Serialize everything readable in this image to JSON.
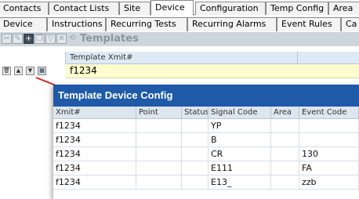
{
  "main_tabs": [
    {
      "label": "Contacts"
    },
    {
      "label": "Contact Lists"
    },
    {
      "label": "Site"
    },
    {
      "label": "Device",
      "active": true
    },
    {
      "label": "Configuration"
    },
    {
      "label": "Temp Config"
    },
    {
      "label": "Area"
    }
  ],
  "sub_tabs": [
    {
      "label": "Device"
    },
    {
      "label": "Instructions"
    },
    {
      "label": "Recurring Tests"
    },
    {
      "label": "Recurring Alarms"
    },
    {
      "label": "Event Rules"
    },
    {
      "label": "Ca"
    }
  ],
  "toolbar": {
    "title": "Templates",
    "icons": [
      "cut-icon",
      "edit-icon",
      "add-icon",
      "copy-icon",
      "filter-icon",
      "delete-icon",
      "refresh-icon"
    ]
  },
  "templates_grid": {
    "columns": [
      "Template Xmit#"
    ],
    "rows": [
      {
        "xmit": "f1234"
      }
    ]
  },
  "popup": {
    "title": "Template Device Config",
    "columns": [
      "Xmit#",
      "Point",
      "Status",
      "Signal Code",
      "Area",
      "Event Code"
    ],
    "rows": [
      {
        "xmit": "f1234",
        "point": "",
        "status": "",
        "signal_code": "YP",
        "area": "",
        "event_code": ""
      },
      {
        "xmit": "f1234",
        "point": "",
        "status": "",
        "signal_code": "B",
        "area": "",
        "event_code": ""
      },
      {
        "xmit": "f1234",
        "point": "",
        "status": "",
        "signal_code": "CR",
        "area": "",
        "event_code": "130"
      },
      {
        "xmit": "f1234",
        "point": "",
        "status": "",
        "signal_code": "E111",
        "area": "",
        "event_code": "FA"
      },
      {
        "xmit": "f1234",
        "point": "",
        "status": "",
        "signal_code": "E13_",
        "area": "",
        "event_code": "zzb"
      }
    ]
  },
  "colors": {
    "popup_title_bg": "#1e5aa8",
    "selected_row_bg": "#fffdd0",
    "toolbar_bg": "#cfd5dc",
    "arrow": "#e02020"
  }
}
